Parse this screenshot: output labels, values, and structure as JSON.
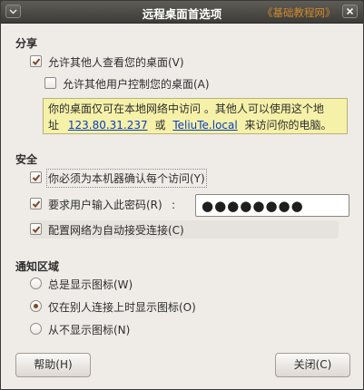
{
  "window": {
    "title": "远程桌面首选项",
    "watermark": "《基础教程网》"
  },
  "sharing": {
    "header": "分享",
    "allow_view": {
      "label": "允许其他人查看您的桌面(V)",
      "checked": true
    },
    "allow_control": {
      "label": "允许其他用户控制您的桌面(A)",
      "checked": false
    },
    "info": {
      "text1": "你的桌面仅可在本地网络中访问 。其他人可以使用这个地",
      "text2": "址",
      "ip": "123.80.31.237",
      "or": "或",
      "host": "TeliuTe.local",
      "text3": "来访问你的电脑。"
    }
  },
  "security": {
    "header": "安全",
    "confirm_access": {
      "label": "你必须为本机器确认每个访问(Y)",
      "checked": true
    },
    "require_password": {
      "label": "要求用户输入此密码(R)",
      "checked": true,
      "separator": ":"
    },
    "password_value": "●●●●●●●●",
    "auto_accept": {
      "label": "配置网络为自动接受连接(C)",
      "checked": true
    }
  },
  "notification": {
    "header": "通知区域",
    "always": {
      "label": "总是显示图标(W)",
      "selected": false
    },
    "only_connected": {
      "label": "仅在别人连接上时显示图标(O)",
      "selected": true
    },
    "never": {
      "label": "从不显示图标(N)",
      "selected": false
    }
  },
  "buttons": {
    "help": "帮助(H)",
    "close": "关闭(C)"
  },
  "colors": {
    "title_bg": "#3d3c38",
    "dialog_bg": "#efebe7",
    "info_bg": "#f5f1a8",
    "link": "#0b3cc2",
    "watermark": "#d08a2c",
    "accent": "#7b4a2a"
  },
  "icons": {
    "window_menu": "window-menu-icon",
    "close": "close-icon",
    "checkbox": "checkmark-icon",
    "radio": "radio-dot-icon"
  }
}
